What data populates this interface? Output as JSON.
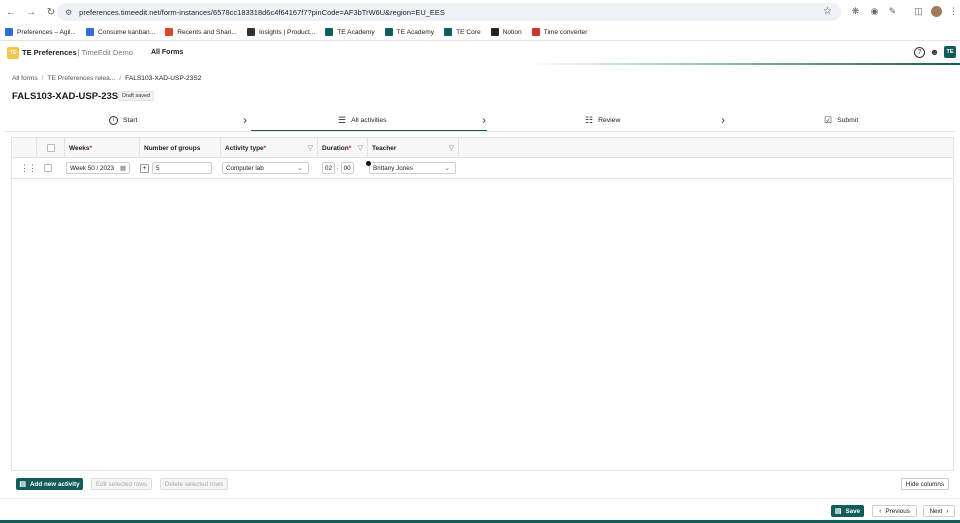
{
  "browser": {
    "url": "preferences.timeedit.net/form-instances/6578cc183318d6c4f64167f7?pinCode=AF3bTrW6U&region=EU_EES",
    "bookmarks": [
      {
        "label": "Preferences – Agil...",
        "color": "#2f6fd6"
      },
      {
        "label": "Consume kanban...",
        "color": "#2f6fd6"
      },
      {
        "label": "Recents and Shari...",
        "color": "#e0452f"
      },
      {
        "label": "Insights | Product...",
        "color": "#333333"
      },
      {
        "label": "TE Academy",
        "color": "#135c5c"
      },
      {
        "label": "TE Academy",
        "color": "#135c5c"
      },
      {
        "label": "TE Core",
        "color": "#135c5c"
      },
      {
        "label": "Notion",
        "color": "#222222"
      },
      {
        "label": "Time converter",
        "color": "#d32f2f"
      }
    ]
  },
  "app": {
    "title": "TE Preferences",
    "subtitle": "| TimeEdit Demo",
    "nav_all_forms": "All Forms",
    "avatar": "TE",
    "logo_text": "TE",
    "accent": "#135c5c"
  },
  "breadcrumb": [
    "All forms",
    "TE Preferences relea...",
    "FALS103-XAD-USP-23S2"
  ],
  "form": {
    "title": "FALS103-XAD-USP-23S2",
    "status": "Draft saved"
  },
  "steps": [
    {
      "label": "Start",
      "icon": "info-icon"
    },
    {
      "label": "All activities",
      "icon": "list-icon",
      "active": true
    },
    {
      "label": "Review",
      "icon": "review-icon"
    },
    {
      "label": "Submit",
      "icon": "submit-icon"
    }
  ],
  "table": {
    "columns": [
      {
        "label": "Weeks",
        "required": true
      },
      {
        "label": "Number of groups",
        "required": false
      },
      {
        "label": "Activity type",
        "required": true
      },
      {
        "label": "Duration",
        "required": true
      },
      {
        "label": "Teacher",
        "required": false
      }
    ],
    "rows": [
      {
        "weeks": "Week 50 / 2023",
        "groups": "5",
        "activity_type": "Computer lab",
        "duration_hours": "02",
        "duration_minutes": "00",
        "teacher": "Brittany Jones"
      }
    ]
  },
  "actions": {
    "add_new_activity": "Add new activity",
    "edit_selected_rows": "Edit selected rows",
    "delete_selected_rows": "Delete selected rows",
    "hide_columns": "Hide columns",
    "save": "Save",
    "previous": "Previous",
    "next": "Next"
  }
}
